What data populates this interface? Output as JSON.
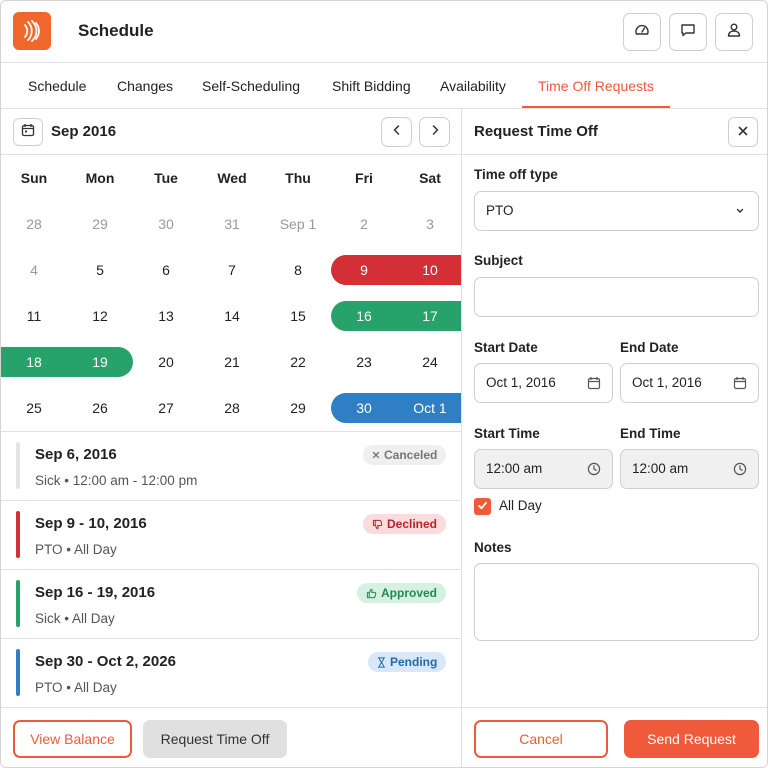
{
  "header": {
    "title": "Schedule",
    "logo_icon": "wave-logo-icon",
    "buttons": [
      "dashboard-icon",
      "chat-icon",
      "user-icon"
    ]
  },
  "tabs": [
    {
      "label": "Schedule"
    },
    {
      "label": "Changes"
    },
    {
      "label": "Self-Scheduling"
    },
    {
      "label": "Shift Bidding"
    },
    {
      "label": "Availability"
    },
    {
      "label": "Time Off Requests",
      "active": true
    }
  ],
  "calendar": {
    "month_label": "Sep 2016",
    "weekdays": [
      "Sun",
      "Mon",
      "Tue",
      "Wed",
      "Thu",
      "Fri",
      "Sat"
    ],
    "weeks": [
      [
        "28",
        "29",
        "30",
        "31",
        "Sep 1",
        "2",
        "3"
      ],
      [
        "4",
        "5",
        "6",
        "7",
        "8",
        "9",
        "10"
      ],
      [
        "11",
        "12",
        "13",
        "14",
        "15",
        "16",
        "17"
      ],
      [
        "18",
        "19",
        "20",
        "21",
        "22",
        "23",
        "24"
      ],
      [
        "25",
        "26",
        "27",
        "28",
        "29",
        "30",
        "Oct 1"
      ]
    ],
    "muted": [
      [
        0,
        0
      ],
      [
        0,
        1
      ],
      [
        0,
        2
      ],
      [
        0,
        3
      ],
      [
        0,
        4
      ],
      [
        0,
        5
      ],
      [
        0,
        6
      ],
      [
        1,
        0
      ]
    ],
    "bars": [
      {
        "week": 1,
        "from": 5,
        "to": 6,
        "color": "#d42e36",
        "round_left": true,
        "round_right": false
      },
      {
        "week": 2,
        "from": 5,
        "to": 6,
        "color": "#27a26b",
        "round_left": true,
        "round_right": false
      },
      {
        "week": 3,
        "from": 0,
        "to": 1,
        "color": "#27a26b",
        "round_left": false,
        "round_right": true
      },
      {
        "week": 4,
        "from": 5,
        "to": 6,
        "color": "#2f7fc4",
        "round_left": true,
        "round_right": false
      }
    ]
  },
  "requests": [
    {
      "date": "Sep 6, 2016",
      "type": "Sick",
      "time": "12:00 am - 12:00 pm",
      "status": "Canceled",
      "status_icon": "x-icon",
      "stripe": "#e4e4e4",
      "badge_bg": "#efefef",
      "badge_fg": "#777777"
    },
    {
      "date": "Sep 9 - 10, 2016",
      "type": "PTO",
      "time": "All Day",
      "status": "Declined",
      "status_icon": "thumbs-down-icon",
      "stripe": "#d42e36",
      "badge_bg": "#fbdcdc",
      "badge_fg": "#b3252c"
    },
    {
      "date": "Sep 16 - 19, 2016",
      "type": "Sick",
      "time": "All Day",
      "status": "Approved",
      "status_icon": "thumbs-up-icon",
      "stripe": "#27a26b",
      "badge_bg": "#d5f1e2",
      "badge_fg": "#1f8a57"
    },
    {
      "date": "Sep 30 - Oct 2, 2026",
      "type": "PTO",
      "time": "All Day",
      "status": "Pending",
      "status_icon": "hourglass-icon",
      "stripe": "#2f7fc4",
      "badge_bg": "#d8e8f8",
      "badge_fg": "#236aa8"
    }
  ],
  "footer_left": {
    "view_balance": "View Balance",
    "request_time_off": "Request Time Off"
  },
  "form": {
    "title": "Request Time Off",
    "time_off_type_label": "Time off type",
    "time_off_type_value": "PTO",
    "subject_label": "Subject",
    "subject_value": "",
    "start_date_label": "Start Date",
    "start_date_value": "Oct 1, 2016",
    "end_date_label": "End Date",
    "end_date_value": "Oct 1, 2016",
    "start_time_label": "Start Time",
    "start_time_value": "12:00 am",
    "end_time_label": "End Time",
    "end_time_value": "12:00 am",
    "all_day_label": "All Day",
    "all_day_checked": true,
    "notes_label": "Notes",
    "notes_value": "",
    "cancel_label": "Cancel",
    "send_label": "Send Request"
  },
  "colors": {
    "accent": "#ee5a3a",
    "declined": "#d42e36",
    "approved": "#27a26b",
    "pending": "#2f7fc4"
  }
}
